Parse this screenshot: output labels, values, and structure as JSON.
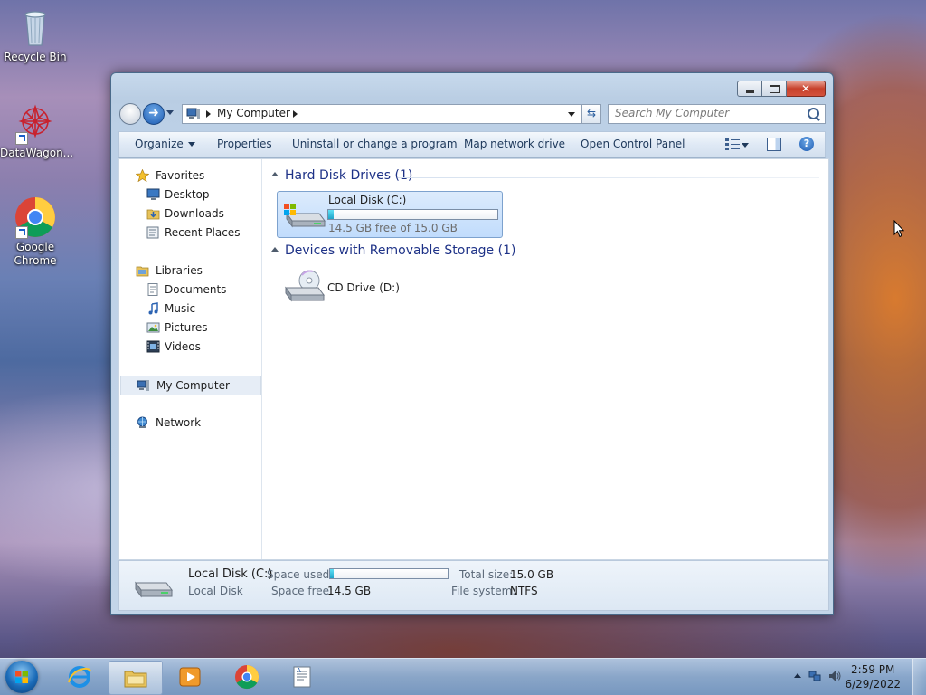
{
  "desktop": {
    "icons": [
      {
        "label": "Recycle Bin"
      },
      {
        "label": "DataWagon..."
      },
      {
        "label": "Google Chrome"
      }
    ]
  },
  "window": {
    "address": {
      "crumb": "My Computer"
    },
    "search": {
      "placeholder": "Search My Computer"
    },
    "commands": {
      "organize": "Organize",
      "properties": "Properties",
      "uninstall": "Uninstall or change a program",
      "map_drive": "Map network drive",
      "control_panel": "Open Control Panel"
    },
    "nav": {
      "favorites": "Favorites",
      "desktop": "Desktop",
      "downloads": "Downloads",
      "recent": "Recent Places",
      "libraries": "Libraries",
      "documents": "Documents",
      "music": "Music",
      "pictures": "Pictures",
      "videos": "Videos",
      "computer": "My Computer",
      "network": "Network"
    },
    "groups": {
      "hdd_header": "Hard Disk Drives (1)",
      "removable_header": "Devices with Removable Storage (1)"
    },
    "drives": {
      "c": {
        "name": "Local Disk (C:)",
        "free_text": "14.5 GB free of 15.0 GB",
        "used_fraction": 0.033
      },
      "d": {
        "name": "CD Drive (D:)"
      }
    },
    "details": {
      "name": "Local Disk (C:)",
      "type": "Local Disk",
      "space_used_label": "Space used:",
      "space_free_label": "Space free:",
      "space_free_value": "14.5 GB",
      "total_label": "Total size:",
      "total_value": "15.0 GB",
      "fs_label": "File system:",
      "fs_value": "NTFS"
    }
  },
  "taskbar": {
    "clock_time": "2:59 PM",
    "clock_date": "6/29/2022"
  }
}
